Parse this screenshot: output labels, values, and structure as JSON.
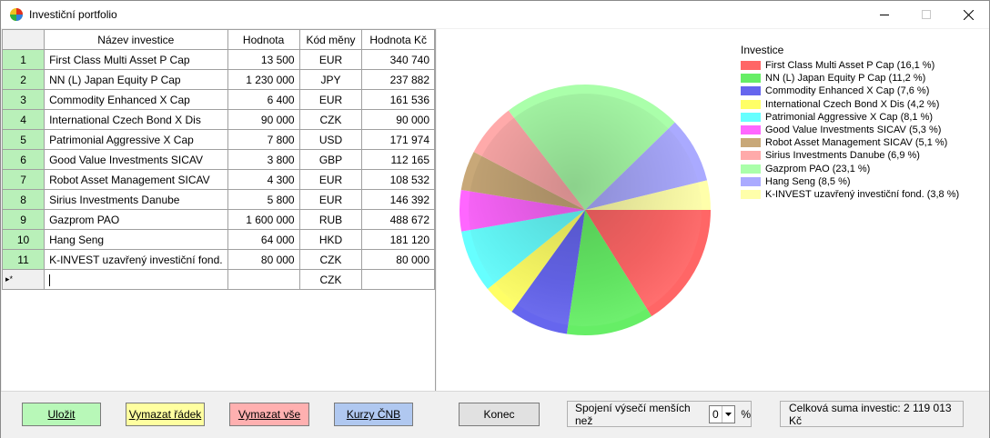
{
  "window": {
    "title": "Investiční portfolio",
    "minimize_icon": "minimize-icon",
    "maximize_icon": "maximize-icon",
    "close_icon": "close-icon"
  },
  "grid": {
    "columns": [
      "Název investice",
      "Hodnota",
      "Kód měny",
      "Hodnota Kč"
    ],
    "rows": [
      {
        "n": "1",
        "name": "First Class Multi Asset P Cap",
        "value": "13 500",
        "code": "EUR",
        "czk": "340 740"
      },
      {
        "n": "2",
        "name": "NN (L) Japan Equity P Cap",
        "value": "1 230 000",
        "code": "JPY",
        "czk": "237 882"
      },
      {
        "n": "3",
        "name": "Commodity Enhanced X Cap",
        "value": "6 400",
        "code": "EUR",
        "czk": "161 536"
      },
      {
        "n": "4",
        "name": "International Czech Bond X Dis",
        "value": "90 000",
        "code": "CZK",
        "czk": "90 000"
      },
      {
        "n": "5",
        "name": "Patrimonial Aggressive X Cap",
        "value": "7 800",
        "code": "USD",
        "czk": "171 974"
      },
      {
        "n": "6",
        "name": "Good Value Investments SICAV",
        "value": "3 800",
        "code": "GBP",
        "czk": "112 165"
      },
      {
        "n": "7",
        "name": "Robot Asset Management SICAV",
        "value": "4 300",
        "code": "EUR",
        "czk": "108 532"
      },
      {
        "n": "8",
        "name": "Sirius Investments Danube",
        "value": "5 800",
        "code": "EUR",
        "czk": "146 392"
      },
      {
        "n": "9",
        "name": "Gazprom PAO",
        "value": "1 600 000",
        "code": "RUB",
        "czk": "488 672"
      },
      {
        "n": "10",
        "name": "Hang Seng",
        "value": "64 000",
        "code": "HKD",
        "czk": "181 120"
      },
      {
        "n": "11",
        "name": "K-INVEST uzavřený investiční fond.",
        "value": "80 000",
        "code": "CZK",
        "czk": "80 000"
      }
    ],
    "new_row": {
      "marker": "▸*",
      "code": "CZK"
    }
  },
  "chart_data": {
    "type": "pie",
    "legend_title": "Investice",
    "legend_position": "top-right",
    "series": [
      {
        "name": "First Class Multi Asset P Cap (16,1 %)",
        "value": 16.1,
        "color": "#ff6666"
      },
      {
        "name": "NN (L) Japan Equity P Cap (11,2 %)",
        "value": 11.2,
        "color": "#66ee66"
      },
      {
        "name": "Commodity Enhanced X Cap (7,6 %)",
        "value": 7.6,
        "color": "#6666ee"
      },
      {
        "name": "International Czech Bond X Dis (4,2 %)",
        "value": 4.2,
        "color": "#ffff66"
      },
      {
        "name": "Patrimonial Aggressive X Cap (8,1 %)",
        "value": 8.1,
        "color": "#66ffff"
      },
      {
        "name": "Good Value Investments SICAV (5,3 %)",
        "value": 5.3,
        "color": "#ff66ff"
      },
      {
        "name": "Robot Asset Management SICAV (5,1 %)",
        "value": 5.1,
        "color": "#c8a878"
      },
      {
        "name": "Sirius Investments Danube (6,9 %)",
        "value": 6.9,
        "color": "#ffaaaa"
      },
      {
        "name": "Gazprom PAO (23,1 %)",
        "value": 23.1,
        "color": "#aaffaa"
      },
      {
        "name": "Hang Seng  (8,5 %)",
        "value": 8.5,
        "color": "#aaaaff"
      },
      {
        "name": "K-INVEST uzavřený investiční fond. (3,8 %)",
        "value": 3.8,
        "color": "#ffffaa"
      }
    ]
  },
  "buttons": {
    "save": "Uložit",
    "clear_row": "Vymazat řádek",
    "clear_all": "Vymazat vše",
    "cnb_rates": "Kurzy ČNB",
    "exit": "Konec"
  },
  "merge": {
    "label": "Spojení výsečí menších než",
    "value": "0",
    "unit": "%"
  },
  "total": {
    "text": "Celková suma investic:  2 119 013 Kč"
  },
  "colors": {
    "save": "#b8f8b8",
    "clear_row": "#ffffa0",
    "clear_all": "#ffb0b0",
    "cnb": "#b0c8f0",
    "row_header": "#b9f0b9"
  }
}
